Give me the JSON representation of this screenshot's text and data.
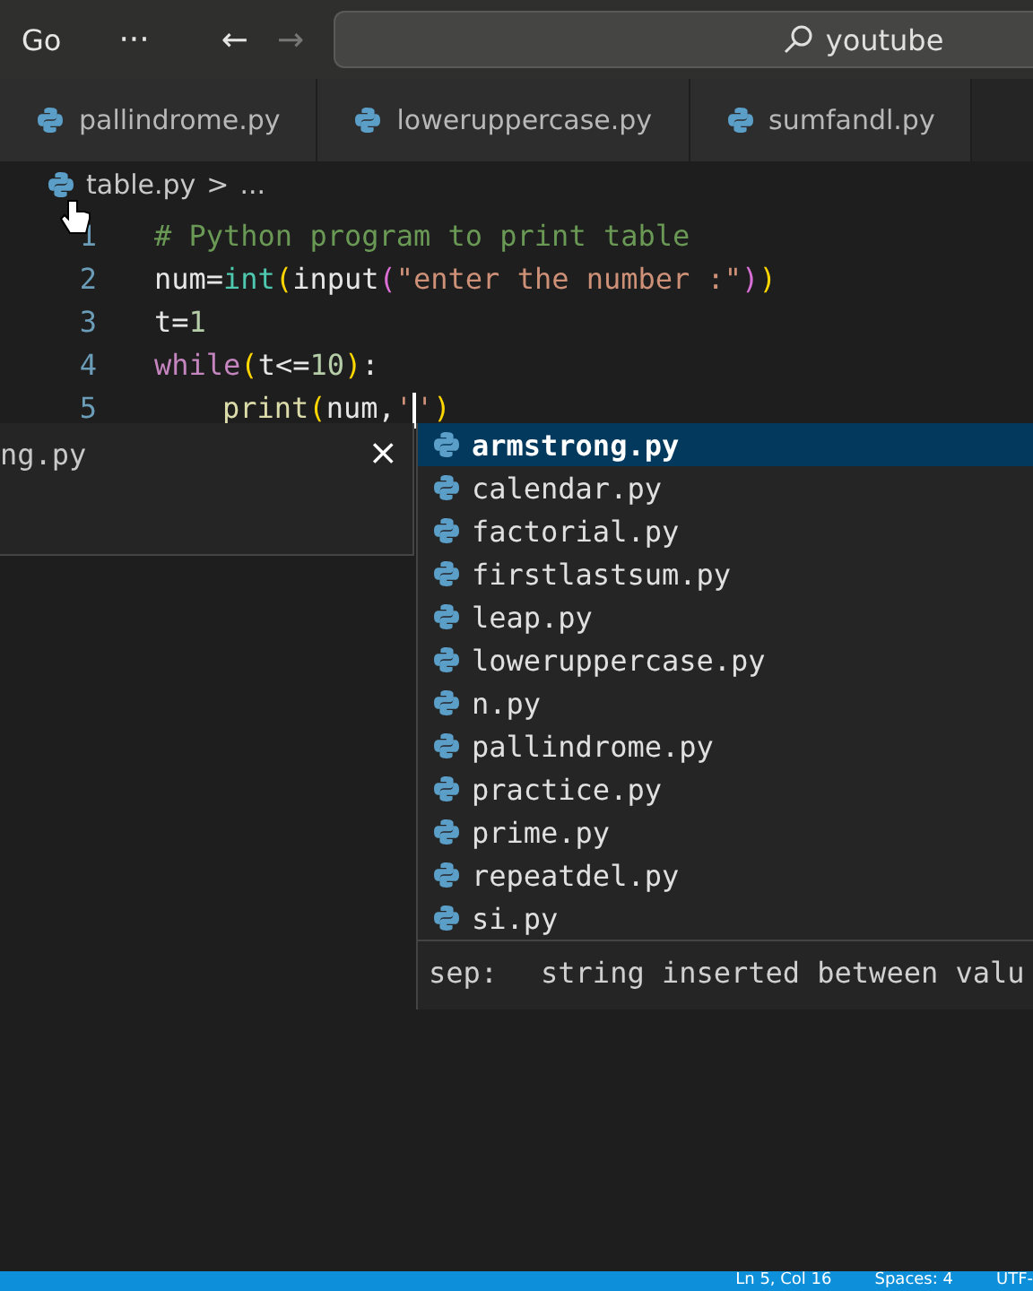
{
  "title_bar": {
    "menu": "Go",
    "more": "···",
    "back": "←",
    "forward": "→",
    "search": "youtube"
  },
  "tabs": [
    {
      "label": "pallindrome.py",
      "selected": false
    },
    {
      "label": "loweruppercase.py",
      "selected": false
    },
    {
      "label": "sumfandl.py",
      "selected": false
    }
  ],
  "breadcrumb": {
    "file": "table.py",
    "separator": ">",
    "rest": "..."
  },
  "editor": {
    "lines": [
      {
        "number": "1",
        "tokens": [
          {
            "kind": "comment",
            "text": "# Python program to print table"
          }
        ]
      },
      {
        "number": "2",
        "tokens": [
          {
            "kind": "plain",
            "text": "num="
          },
          {
            "kind": "builtin",
            "text": "int"
          },
          {
            "kind": "paren",
            "text": "("
          },
          {
            "kind": "plain",
            "text": "input"
          },
          {
            "kind": "paren2",
            "text": "("
          },
          {
            "kind": "string",
            "text": "\"enter the number :\""
          },
          {
            "kind": "paren2",
            "text": ")"
          },
          {
            "kind": "paren",
            "text": ")"
          }
        ]
      },
      {
        "number": "3",
        "tokens": [
          {
            "kind": "plain",
            "text": "t="
          },
          {
            "kind": "number",
            "text": "1"
          }
        ]
      },
      {
        "number": "4",
        "tokens": [
          {
            "kind": "keyword",
            "text": "while"
          },
          {
            "kind": "paren",
            "text": "("
          },
          {
            "kind": "plain",
            "text": "t<="
          },
          {
            "kind": "number",
            "text": "10"
          },
          {
            "kind": "paren",
            "text": ")"
          },
          {
            "kind": "plain",
            "text": ":"
          }
        ]
      },
      {
        "number": "5",
        "tokens": [
          {
            "kind": "indent"
          },
          {
            "kind": "function",
            "text": "print"
          },
          {
            "kind": "paren",
            "text": "("
          },
          {
            "kind": "plain",
            "text": "num,"
          },
          {
            "kind": "string",
            "text": "'"
          },
          {
            "kind": "cursor"
          },
          {
            "kind": "string",
            "text": "'"
          },
          {
            "kind": "paren",
            "text": ")"
          }
        ]
      }
    ]
  },
  "peek_panel": {
    "title": "ng.py",
    "close": "×"
  },
  "suggestions": [
    {
      "label": "armstrong.py",
      "selected": true
    },
    {
      "label": "calendar.py",
      "selected": false
    },
    {
      "label": "factorial.py",
      "selected": false
    },
    {
      "label": "firstlastsum.py",
      "selected": false
    },
    {
      "label": "leap.py",
      "selected": false
    },
    {
      "label": "loweruppercase.py",
      "selected": false
    },
    {
      "label": "n.py",
      "selected": false
    },
    {
      "label": "pallindrome.py",
      "selected": false
    },
    {
      "label": "practice.py",
      "selected": false
    },
    {
      "label": "prime.py",
      "selected": false
    },
    {
      "label": "repeatdel.py",
      "selected": false
    },
    {
      "label": "si.py",
      "selected": false
    }
  ],
  "hover_doc": {
    "param": "sep:",
    "text": "string inserted between valu"
  },
  "status_bar": [
    "Ln 5, Col 16",
    "Spaces: 4",
    "UTF-"
  ]
}
